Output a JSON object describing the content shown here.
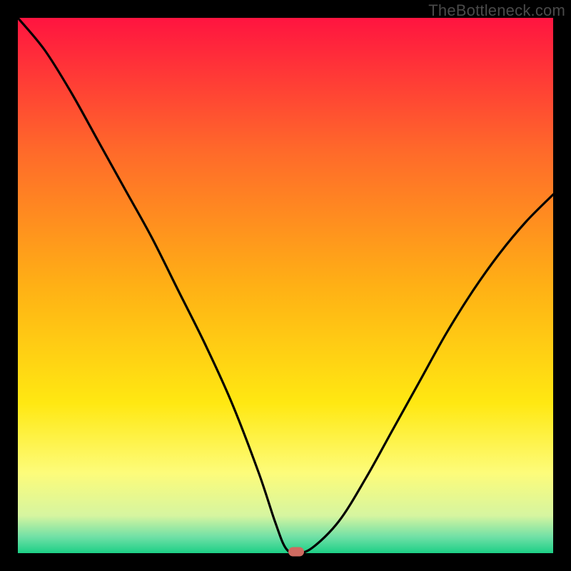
{
  "watermark": "TheBottleneck.com",
  "chart_data": {
    "type": "line",
    "title": "",
    "xlabel": "",
    "ylabel": "",
    "xlim": [
      0,
      100
    ],
    "ylim": [
      0,
      100
    ],
    "grid": false,
    "legend": false,
    "annotations": [],
    "background_gradient": {
      "stops": [
        {
          "offset": 0,
          "color": "#ff1440"
        },
        {
          "offset": 25,
          "color": "#ff6a2a"
        },
        {
          "offset": 50,
          "color": "#ffb015"
        },
        {
          "offset": 72,
          "color": "#ffe812"
        },
        {
          "offset": 85,
          "color": "#fdfc7a"
        },
        {
          "offset": 93,
          "color": "#d6f5a0"
        },
        {
          "offset": 97,
          "color": "#6fe0a6"
        },
        {
          "offset": 100,
          "color": "#1ccf86"
        }
      ]
    },
    "series": [
      {
        "name": "bottleneck-curve",
        "color": "#000000",
        "x": [
          0,
          5,
          10,
          15,
          20,
          25,
          30,
          35,
          40,
          45,
          48,
          50,
          52,
          55,
          60,
          65,
          70,
          75,
          80,
          85,
          90,
          95,
          100
        ],
        "y": [
          100,
          94,
          86,
          77,
          68,
          59,
          49,
          39,
          28,
          15,
          6,
          1,
          0,
          1,
          6,
          14,
          23,
          32,
          41,
          49,
          56,
          62,
          67
        ]
      }
    ],
    "marker": {
      "x": 52,
      "y": 0,
      "color": "#cf6a60"
    }
  }
}
